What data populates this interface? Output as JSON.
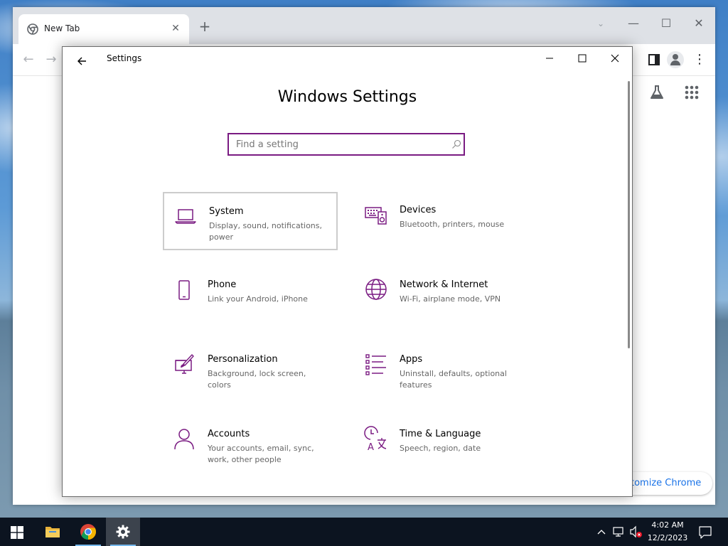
{
  "colors": {
    "accent": "#7a1b82",
    "chrome_link": "#1a73e8",
    "taskbar": "#0c1420"
  },
  "chrome": {
    "tab_title": "New Tab",
    "customize_label": "Customize Chrome",
    "customize_visible_text": "tomize Chrome"
  },
  "settings": {
    "window_title": "Settings",
    "heading": "Windows Settings",
    "search_placeholder": "Find a setting",
    "categories": [
      {
        "name": "System",
        "desc": "Display, sound, notifications, power",
        "icon": "laptop-icon",
        "selected": true
      },
      {
        "name": "Devices",
        "desc": "Bluetooth, printers, mouse",
        "icon": "keyboard-speaker-icon"
      },
      {
        "name": "Phone",
        "desc": "Link your Android, iPhone",
        "icon": "phone-icon"
      },
      {
        "name": "Network & Internet",
        "desc": "Wi-Fi, airplane mode, VPN",
        "icon": "globe-icon"
      },
      {
        "name": "Personalization",
        "desc": "Background, lock screen, colors",
        "icon": "paint-brush-icon"
      },
      {
        "name": "Apps",
        "desc": "Uninstall, defaults, optional features",
        "icon": "apps-list-icon"
      },
      {
        "name": "Accounts",
        "desc": "Your accounts, email, sync, work, other people",
        "icon": "person-icon"
      },
      {
        "name": "Time & Language",
        "desc": "Speech, region, date",
        "icon": "time-language-icon"
      }
    ]
  },
  "taskbar": {
    "time": "4:02 AM",
    "date": "12/2/2023",
    "apps": [
      "start-button",
      "file-explorer",
      "google-chrome",
      "settings"
    ]
  }
}
